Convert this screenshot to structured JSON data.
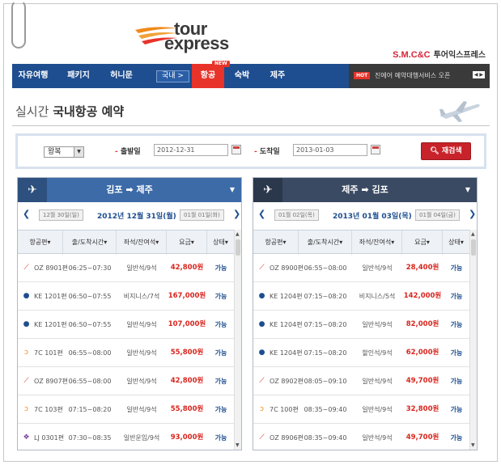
{
  "brand": {
    "logo_line1": "tour",
    "logo_line2": "express",
    "smc": "S.M.C&C",
    "name": "투어익스프레스"
  },
  "nav": {
    "items": [
      {
        "label": "자유여행"
      },
      {
        "label": "패키지"
      },
      {
        "label": "허니문"
      },
      {
        "label": "국내 >"
      },
      {
        "label": "항공",
        "active": true,
        "badge": "NEW"
      },
      {
        "label": "숙박"
      },
      {
        "label": "제주"
      }
    ],
    "ad": {
      "badge": "HOT",
      "text": "진에어 예약대행서비스 오픈",
      "arrows": "◀ ▶"
    }
  },
  "page": {
    "title_light": "실시간",
    "title_bold": "국내항공 예약"
  },
  "search": {
    "trip_type": "왕복",
    "depart_label": "출발일",
    "depart_value": "2012-12-31",
    "arrive_label": "도착일",
    "arrive_value": "2013-01-03",
    "button": "재검색"
  },
  "columns": [
    "항공편",
    "출/도착시간",
    "좌석/잔여석",
    "요금",
    "상태"
  ],
  "outbound": {
    "from": "김포",
    "to": "제주",
    "prev_day": "12월 30일(일)",
    "current_day": "2012년 12월 31일(월)",
    "next_day": "01월 01일(화)",
    "rows": [
      {
        "airline": "OZ",
        "flight": "OZ 8901편",
        "time": "06:25~07:30",
        "seat": "일반석/9석",
        "price": "42,800원",
        "status": "가능"
      },
      {
        "airline": "KE",
        "flight": "KE 1201편",
        "time": "06:50~07:55",
        "seat": "비지니스/7석",
        "price": "167,000원",
        "status": "가능"
      },
      {
        "airline": "KE",
        "flight": "KE 1201편",
        "time": "06:50~07:55",
        "seat": "일반석/9석",
        "price": "107,000원",
        "status": "가능"
      },
      {
        "airline": "7C",
        "flight": "7C 101편",
        "time": "06:55~08:00",
        "seat": "일반석/9석",
        "price": "55,800원",
        "status": "가능"
      },
      {
        "airline": "OZ",
        "flight": "OZ 8907편",
        "time": "06:55~08:00",
        "seat": "일반석/9석",
        "price": "42,800원",
        "status": "가능"
      },
      {
        "airline": "7C",
        "flight": "7C 103편",
        "time": "07:15~08:20",
        "seat": "일반석/9석",
        "price": "55,800원",
        "status": "가능"
      },
      {
        "airline": "LJ",
        "flight": "LJ 0301편",
        "time": "07:30~08:35",
        "seat": "일반운임/9석",
        "price": "93,000원",
        "status": "가능"
      }
    ]
  },
  "inbound": {
    "from": "제주",
    "to": "김포",
    "prev_day": "01월 02일(목)",
    "current_day": "2013년 01월 03일(목)",
    "next_day": "01월 04일(금)",
    "rows": [
      {
        "airline": "OZ",
        "flight": "OZ 8900편",
        "time": "06:55~08:00",
        "seat": "일반석/9석",
        "price": "28,400원",
        "status": "가능"
      },
      {
        "airline": "KE",
        "flight": "KE 1204편",
        "time": "07:15~08:20",
        "seat": "비지니스/5석",
        "price": "142,000원",
        "status": "가능"
      },
      {
        "airline": "KE",
        "flight": "KE 1204편",
        "time": "07:15~08:20",
        "seat": "일반석/9석",
        "price": "82,000원",
        "status": "가능"
      },
      {
        "airline": "KE",
        "flight": "KE 1204편",
        "time": "07:15~08:20",
        "seat": "할인석/9석",
        "price": "62,000원",
        "status": "가능"
      },
      {
        "airline": "OZ",
        "flight": "OZ 8902편",
        "time": "08:05~09:10",
        "seat": "일반석/9석",
        "price": "49,700원",
        "status": "가능"
      },
      {
        "airline": "7C",
        "flight": "7C 100편",
        "time": "08:35~09:40",
        "seat": "일반석/9석",
        "price": "32,800원",
        "status": "가능"
      },
      {
        "airline": "OZ",
        "flight": "OZ 8906편",
        "time": "08:35~09:40",
        "seat": "일반석/9석",
        "price": "49,700원",
        "status": "가능"
      }
    ]
  },
  "icons": {
    "arrow": "➡",
    "prev": "❮",
    "next": "❯",
    "sort": "▾",
    "caret": "▼"
  },
  "colors": {
    "nav_bg": "#1e4e8f",
    "active": "#e8332a",
    "price": "#d8261f",
    "status": "#1e4e8f"
  }
}
